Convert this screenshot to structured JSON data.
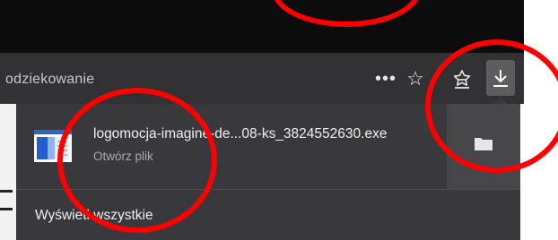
{
  "toolbar": {
    "url_text": "odziekowanie",
    "more_actions_glyph": "•••",
    "bookmark_glyph": "☆"
  },
  "downloads_panel": {
    "item": {
      "file_name": "logomocja-imagine-de...08-ks_3824552630.exe",
      "status": "Otwórz plik",
      "icon": "exe-file-icon"
    },
    "show_all_label": "Wyświetl wszystkie"
  },
  "colors": {
    "titlebar": "#0c0c0d",
    "toolbar": "#323234",
    "panel": "#38383d",
    "panel_side": "#46464b",
    "annotation": "#ff0000"
  }
}
